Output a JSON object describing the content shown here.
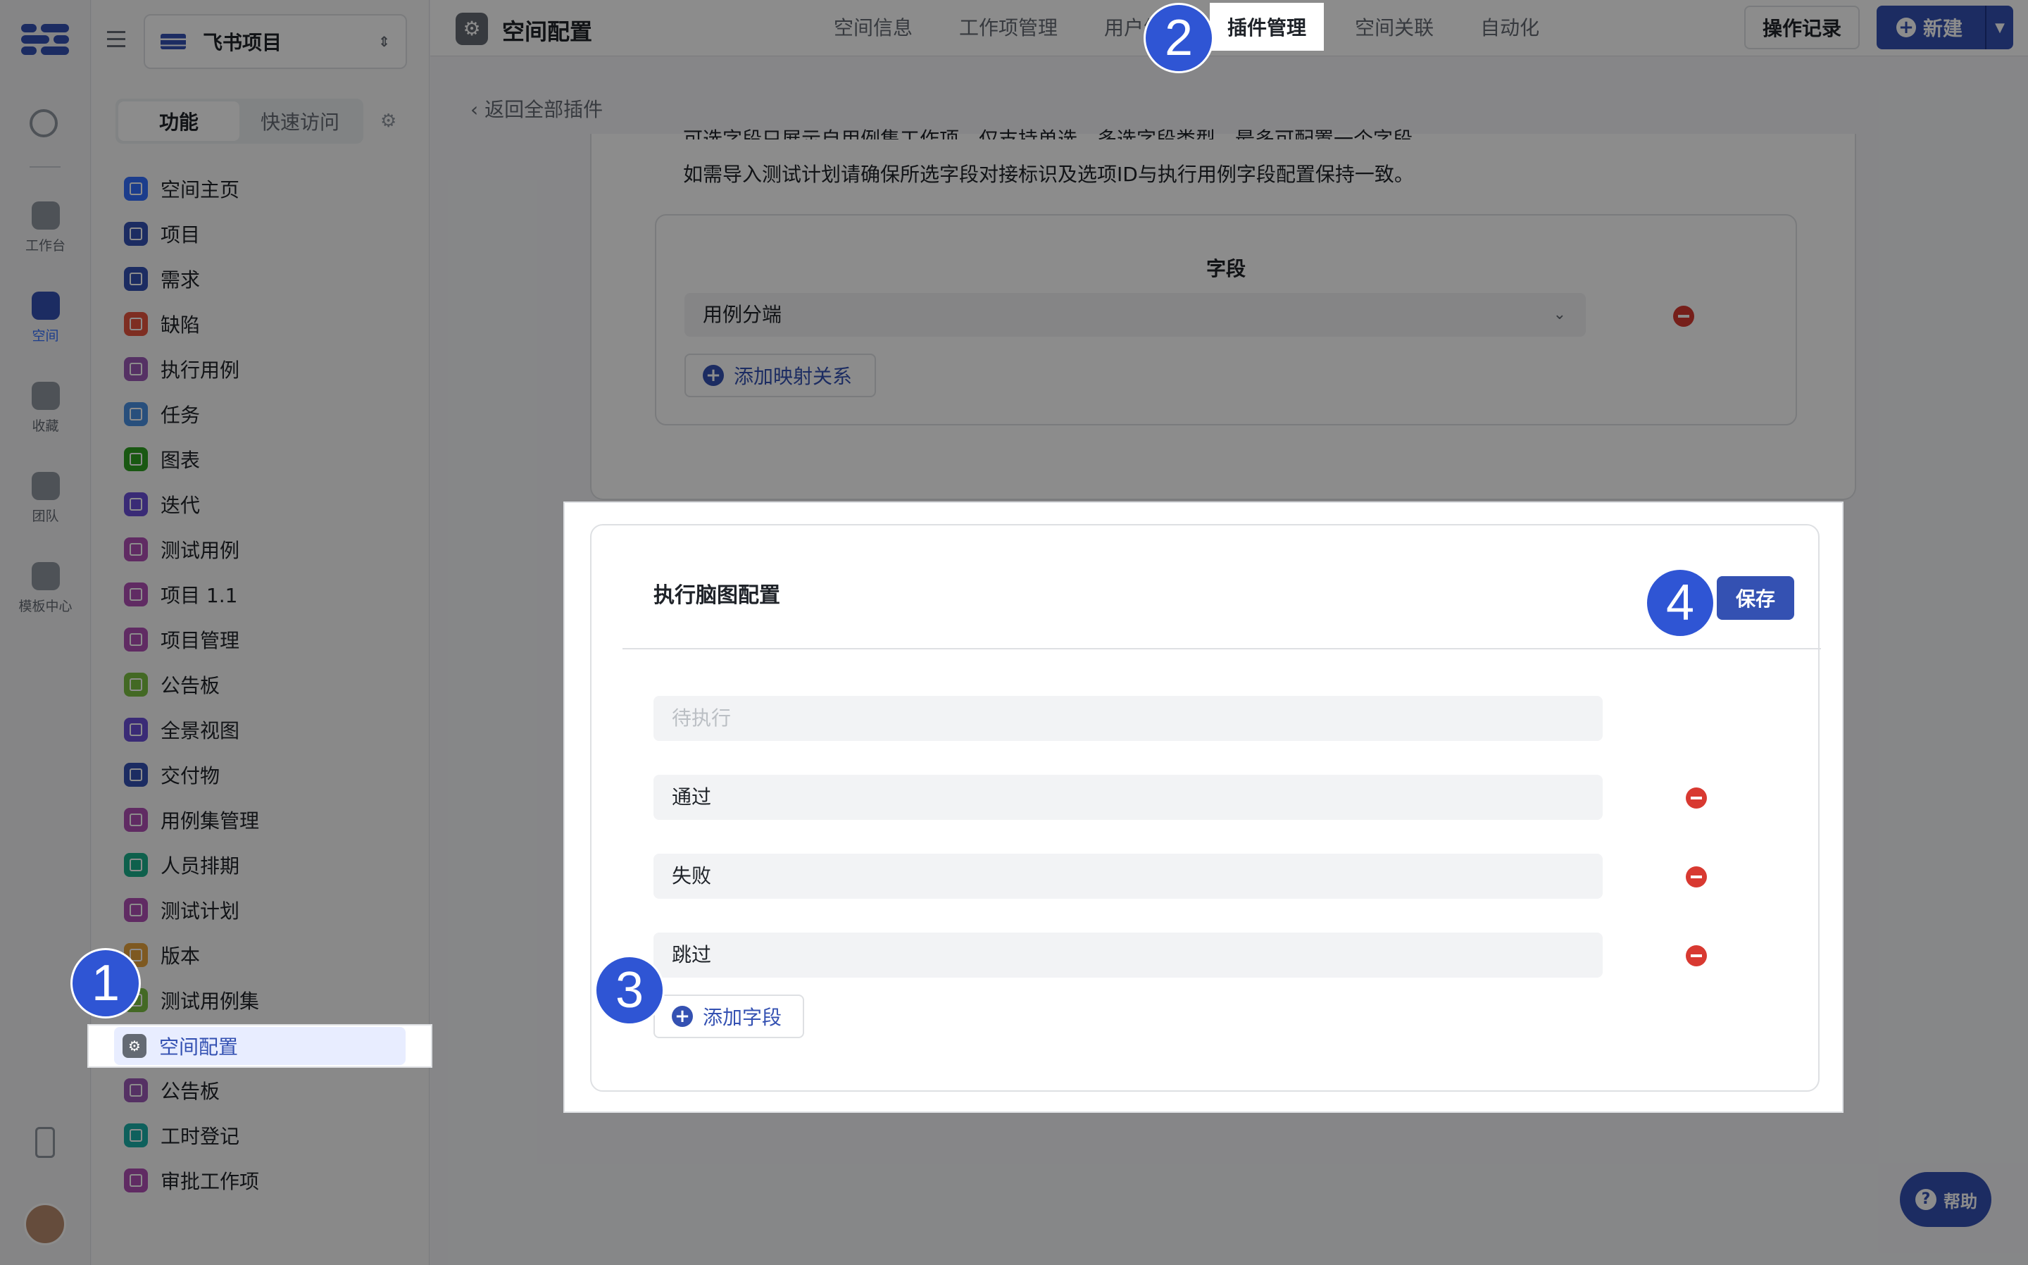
{
  "rail": {
    "items": [
      {
        "label": "工作台",
        "active": false
      },
      {
        "label": "空间",
        "active": true
      },
      {
        "label": "收藏",
        "active": false
      },
      {
        "label": "团队",
        "active": false
      },
      {
        "label": "模板中心",
        "active": false
      }
    ]
  },
  "sidebar": {
    "project_name": "飞书项目",
    "segment": {
      "active": "功能",
      "inactive": "快速访问"
    },
    "items": [
      {
        "label": "空间主页",
        "color": "#3370ff"
      },
      {
        "label": "项目",
        "color": "#3451b2"
      },
      {
        "label": "需求",
        "color": "#3451b2"
      },
      {
        "label": "缺陷",
        "color": "#e6543f"
      },
      {
        "label": "执行用例",
        "color": "#9b59b6"
      },
      {
        "label": "任务",
        "color": "#4a90e2"
      },
      {
        "label": "图表",
        "color": "#2ea121"
      },
      {
        "label": "迭代",
        "color": "#6b4fd8"
      },
      {
        "label": "测试用例",
        "color": "#b04fb4"
      },
      {
        "label": "项目 1.1",
        "color": "#b04fb4"
      },
      {
        "label": "项目管理",
        "color": "#b04fb4"
      },
      {
        "label": "公告板",
        "color": "#7bc043"
      },
      {
        "label": "全景视图",
        "color": "#6b4fd8"
      },
      {
        "label": "交付物",
        "color": "#3451b2"
      },
      {
        "label": "用例集管理",
        "color": "#b04fb4"
      },
      {
        "label": "人员排期",
        "color": "#1bb08a"
      },
      {
        "label": "测试计划",
        "color": "#b04fb4"
      },
      {
        "label": "版本",
        "color": "#e6a23c"
      },
      {
        "label": "测试用例集",
        "color": "#7bc043"
      },
      {
        "label": "空间配置",
        "color": "#646a73"
      },
      {
        "label": "公告板",
        "color": "#9b59b6"
      },
      {
        "label": "工时登记",
        "color": "#1bb0a8"
      },
      {
        "label": "审批工作项",
        "color": "#b04fb4"
      }
    ]
  },
  "topbar": {
    "title": "空间配置",
    "tabs": [
      "空间信息",
      "工作项管理",
      "用户组管",
      "插件管理",
      "空间关联",
      "自动化"
    ],
    "active_tab": "插件管理",
    "log_button": "操作记录",
    "new_button": "新建"
  },
  "back_link": "返回全部插件",
  "mapping_card": {
    "note_line1": "可选字段只展示自用例集工作项，仅支持单选、多选字段类型，最多可配置一个字段。",
    "note_line2": "如需导入测试计划请确保所选字段对接标识及选项ID与执行用例字段配置保持一致。",
    "field_header": "字段",
    "field_value": "用例分端",
    "add_mapping": "添加映射关系"
  },
  "panel": {
    "title": "执行脑图配置",
    "save": "保存",
    "fields": [
      {
        "value": "",
        "placeholder": "待执行",
        "removable": false
      },
      {
        "value": "通过",
        "placeholder": "",
        "removable": true
      },
      {
        "value": "失败",
        "placeholder": "",
        "removable": true
      },
      {
        "value": "跳过",
        "placeholder": "",
        "removable": true
      }
    ],
    "add_field": "添加字段"
  },
  "help": "帮助",
  "callouts": [
    "1",
    "2",
    "3",
    "4"
  ],
  "colors": {
    "accent": "#3451b2",
    "danger": "#d83931",
    "callout": "#2f55d4"
  }
}
